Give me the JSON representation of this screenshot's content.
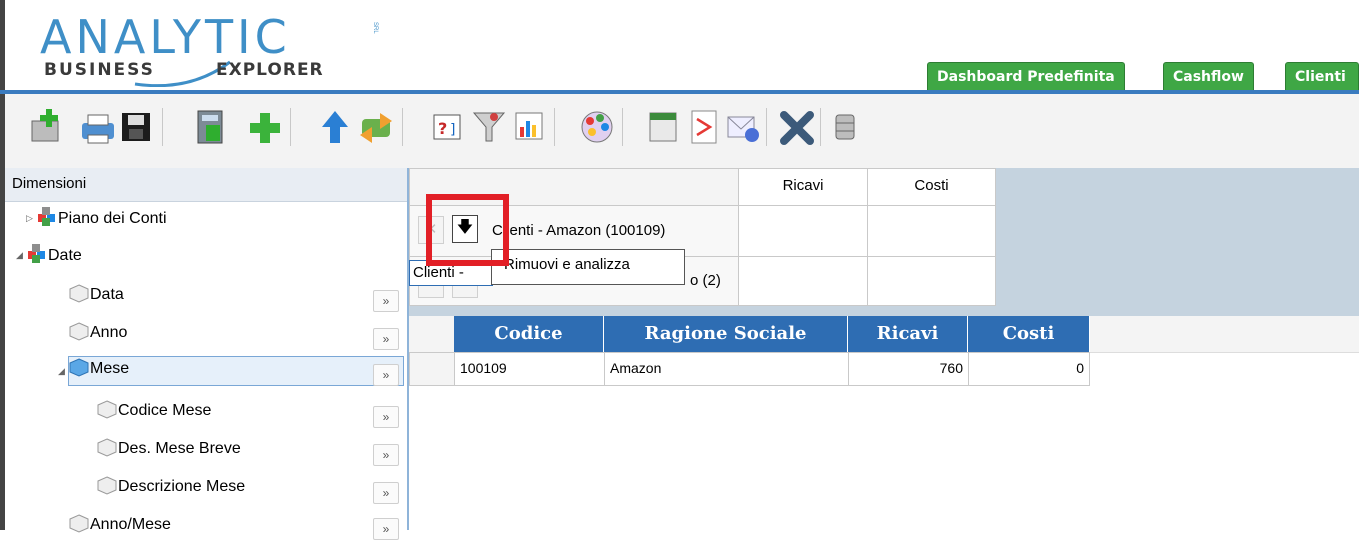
{
  "logo": {
    "title": "ANALYTIC",
    "sub_left": "BUSINESS",
    "sub_right": "EXPLORER",
    "srl": "SRL"
  },
  "tabs": [
    {
      "label": "Dashboard Predefinita"
    },
    {
      "label": "Cashflow"
    },
    {
      "label": "Clienti"
    }
  ],
  "toolbar": {
    "icons": [
      "add-report-icon",
      "print-icon",
      "save-icon",
      "calculator-icon",
      "add-icon",
      "upload-icon",
      "refresh-icon",
      "help-icon",
      "filter-icon",
      "chart-icon",
      "palette-icon",
      "calendar-icon",
      "pdf-icon",
      "email-icon",
      "delete-icon",
      "database-icon"
    ]
  },
  "dimensions": {
    "title": "Dimensioni",
    "items": [
      {
        "label": "Piano dei Conti"
      },
      {
        "label": "Date"
      },
      {
        "label": "Data"
      },
      {
        "label": "Anno"
      },
      {
        "label": "Mese"
      },
      {
        "label": "Codice Mese"
      },
      {
        "label": "Des. Mese Breve"
      },
      {
        "label": "Descrizione Mese"
      },
      {
        "label": "Anno/Mese"
      }
    ],
    "expand_glyph": "»"
  },
  "pivot": {
    "col_ricavi": "Ricavi",
    "col_costi": "Costi",
    "row1_label": "Clienti - Amazon (100109)",
    "row2_label_left": "Clienti -",
    "row2_label_right": "o (2)"
  },
  "tooltip": {
    "text": "Rimuovi e analizza"
  },
  "table": {
    "headers": [
      "Codice",
      "Ragione Sociale",
      "Ricavi",
      "Costi"
    ],
    "rows": [
      {
        "codice": "100109",
        "ragione_sociale": "Amazon",
        "ricavi": "760",
        "costi": "0"
      }
    ]
  },
  "colors": {
    "tab_green": "#3fa745",
    "header_blue": "#2e6db3",
    "highlight_red": "#e21f26",
    "logo_blue": "#3f8fc7"
  }
}
